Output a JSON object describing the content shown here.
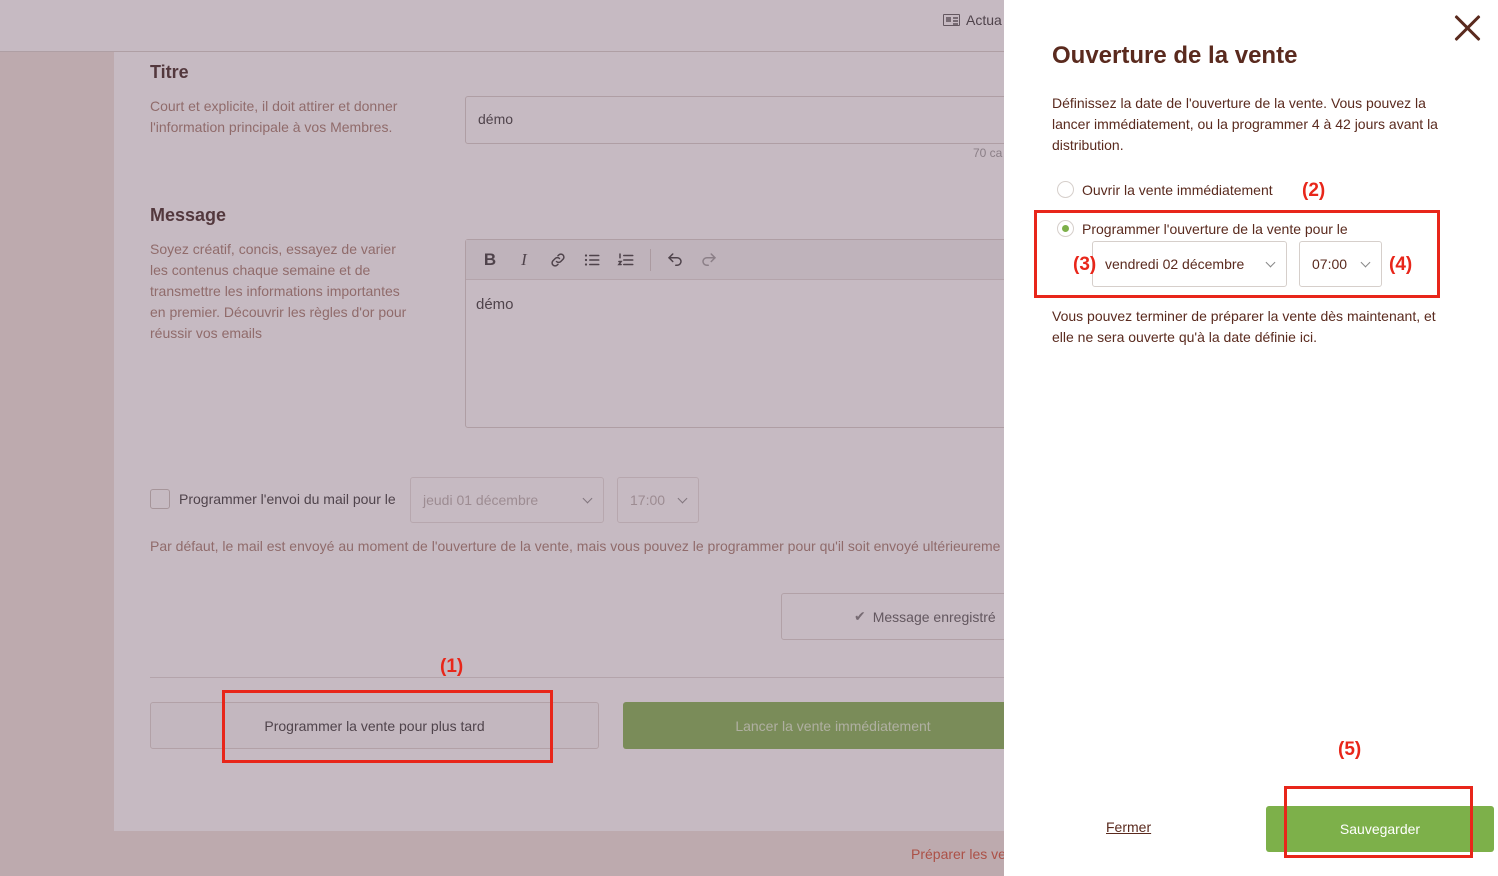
{
  "topbar": {
    "actu_label": "Actua",
    "actu_icon": "newspaper-icon"
  },
  "titre": {
    "heading": "Titre",
    "help": "Court et explicite, il doit attirer et donner l'information principale à vos Membres.",
    "value": "démo",
    "char_count": "70 ca"
  },
  "message": {
    "heading": "Message",
    "help": "Soyez créatif, concis, essayez de varier les contenus chaque semaine et de transmettre les informations importantes en premier. Découvrir les règles d'or pour réussir vos emails",
    "toolbar": {
      "bold": "B",
      "italic": "I"
    },
    "body": "démo"
  },
  "schedule_mail": {
    "label": "Programmer l'envoi du mail pour le",
    "date": "jeudi 01 décembre",
    "time": "17:00",
    "default_note": "Par défaut, le mail est envoyé au moment de l'ouverture de la vente, mais vous pouvez le programmer pour qu'il soit envoyé ultérieureme"
  },
  "saved_button": "Message enregistré",
  "actions": {
    "later": "Programmer la vente pour plus tard",
    "now": "Lancer la vente immédiatement"
  },
  "footer_link": "Préparer les ve",
  "panel": {
    "title": "Ouverture de la vente",
    "description": "Définissez la date de l'ouverture de la vente. Vous pouvez la lancer immédiatement, ou la programmer 4 à 42 jours avant la distribution.",
    "option_now": "Ouvrir la vente immédiatement",
    "option_schedule": "Programmer l'ouverture de la vente pour le",
    "date": "vendredi 02 décembre",
    "time": "07:00",
    "note": "Vous pouvez terminer de préparer la vente dès maintenant, et elle ne sera ouverte qu'à la date définie ici.",
    "close": "Fermer",
    "save": "Sauvegarder"
  },
  "annotations": {
    "a1": "(1)",
    "a2": "(2)",
    "a3": "(3)",
    "a4": "(4)",
    "a5": "(5)",
    "color": "#e8261a"
  },
  "colors": {
    "accent_green": "#7db04a",
    "brand_brown": "#5a2a1e"
  }
}
